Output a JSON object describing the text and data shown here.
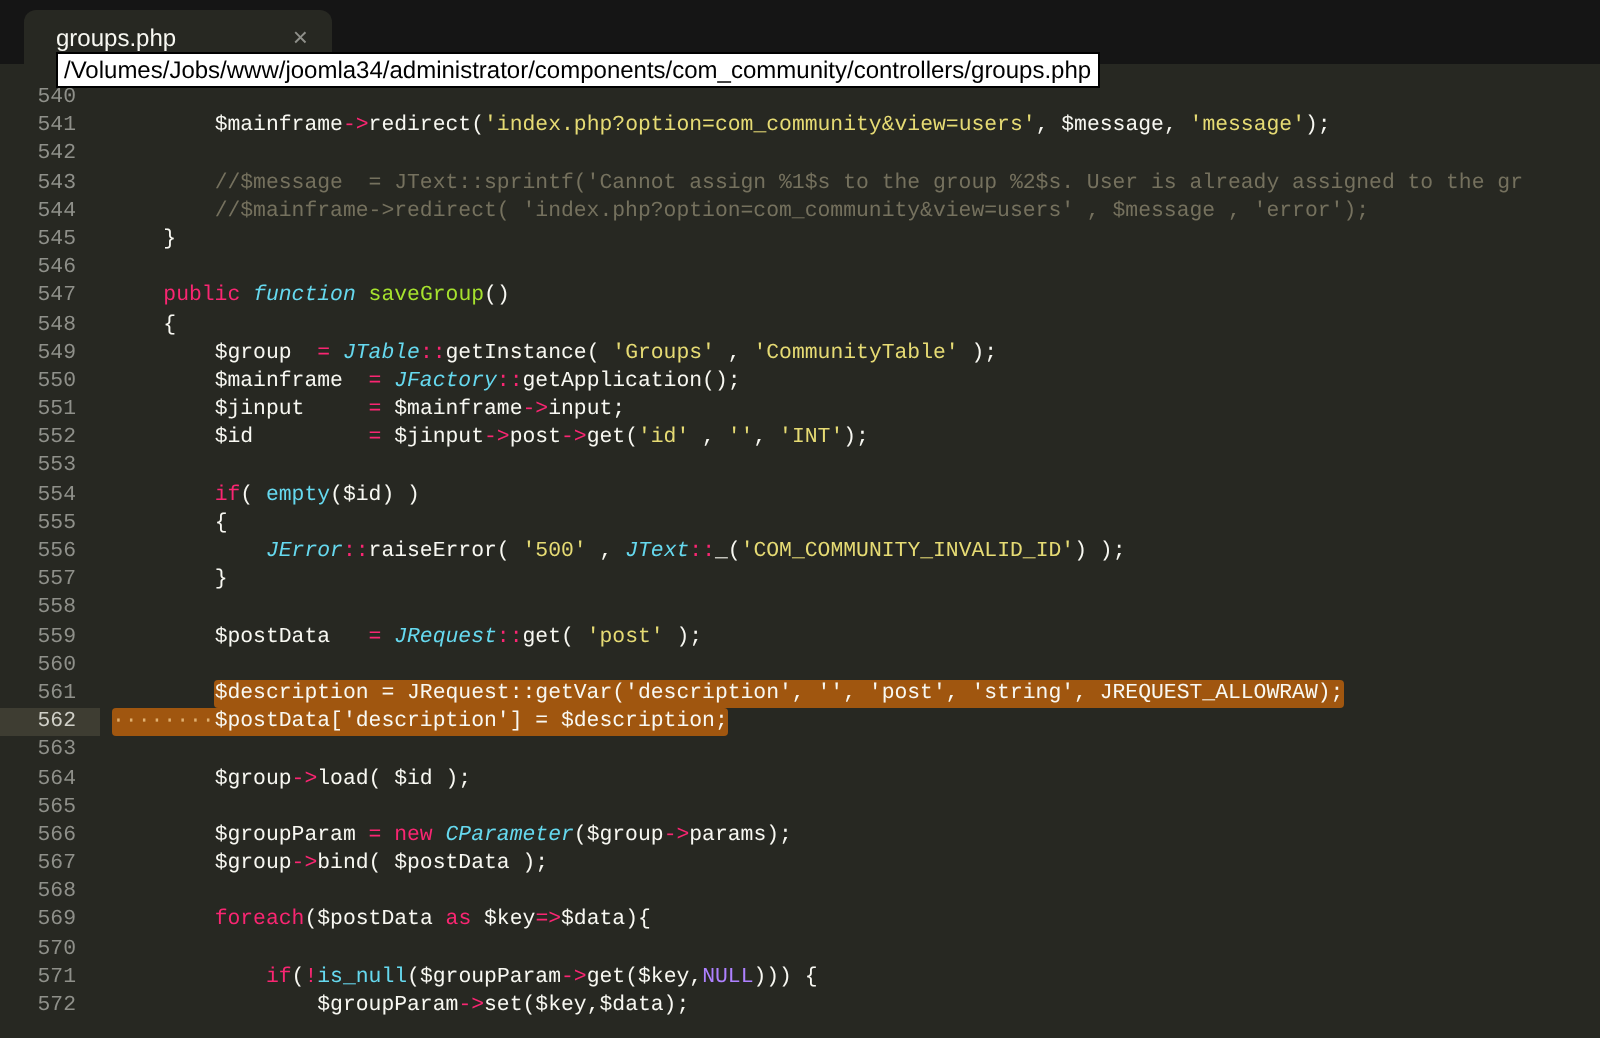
{
  "tab": {
    "title": "groups.php",
    "close": "×",
    "selected": true
  },
  "tooltip": {
    "text": "/Volumes/Jobs/www/joomla34/administrator/components/com_community/controllers/groups.php"
  },
  "lines": [
    {
      "number": "540",
      "selected": false,
      "current": false
    },
    {
      "number": "541",
      "selected": false,
      "current": false,
      "tokens": [
        {
          "text": "        $mainframe",
          "kind": "plain"
        },
        {
          "text": "->",
          "kind": "keyword"
        },
        {
          "text": "redirect(",
          "kind": "plain"
        },
        {
          "text": "'index.php?option=com_community&view=users'",
          "kind": "string"
        },
        {
          "text": ", $message, ",
          "kind": "plain"
        },
        {
          "text": "'message'",
          "kind": "string"
        },
        {
          "text": ");",
          "kind": "plain"
        }
      ]
    },
    {
      "number": "542",
      "selected": false,
      "current": false
    },
    {
      "number": "543",
      "selected": false,
      "current": false,
      "tokens": [
        {
          "text": "        //$message  = JText::sprintf('Cannot assign %1$s to the group %2$s. User is already assigned to the gr",
          "kind": "comment"
        }
      ]
    },
    {
      "number": "544",
      "selected": false,
      "current": false,
      "tokens": [
        {
          "text": "        //$mainframe->redirect( 'index.php?option=com_community&view=users' , $message , 'error');",
          "kind": "comment"
        }
      ]
    },
    {
      "number": "545",
      "selected": false,
      "current": false,
      "tokens": [
        {
          "text": "    }",
          "kind": "plain"
        }
      ]
    },
    {
      "number": "546",
      "selected": false,
      "current": false
    },
    {
      "number": "547",
      "selected": false,
      "current": false,
      "tokens": [
        {
          "text": "    public ",
          "kind": "keyword"
        },
        {
          "text": "function ",
          "kind": "storage"
        },
        {
          "text": "saveGroup",
          "kind": "function"
        },
        {
          "text": "()",
          "kind": "plain"
        }
      ]
    },
    {
      "number": "548",
      "selected": false,
      "current": false,
      "tokens": [
        {
          "text": "    {",
          "kind": "plain"
        }
      ]
    },
    {
      "number": "549",
      "selected": false,
      "current": false,
      "tokens": [
        {
          "text": "        $group  ",
          "kind": "plain"
        },
        {
          "text": "= ",
          "kind": "keyword"
        },
        {
          "text": "JTable",
          "kind": "class"
        },
        {
          "text": "::",
          "kind": "keyword"
        },
        {
          "text": "getInstance( ",
          "kind": "plain"
        },
        {
          "text": "'Groups'",
          "kind": "string"
        },
        {
          "text": " , ",
          "kind": "plain"
        },
        {
          "text": "'CommunityTable'",
          "kind": "string"
        },
        {
          "text": " );",
          "kind": "plain"
        }
      ]
    },
    {
      "number": "550",
      "selected": false,
      "current": false,
      "tokens": [
        {
          "text": "        $mainframe  ",
          "kind": "plain"
        },
        {
          "text": "= ",
          "kind": "keyword"
        },
        {
          "text": "JFactory",
          "kind": "class"
        },
        {
          "text": "::",
          "kind": "keyword"
        },
        {
          "text": "getApplication();",
          "kind": "plain"
        }
      ]
    },
    {
      "number": "551",
      "selected": false,
      "current": false,
      "tokens": [
        {
          "text": "        $jinput     ",
          "kind": "plain"
        },
        {
          "text": "=",
          "kind": "keyword"
        },
        {
          "text": " $mainframe",
          "kind": "plain"
        },
        {
          "text": "->",
          "kind": "keyword"
        },
        {
          "text": "input;",
          "kind": "plain"
        }
      ]
    },
    {
      "number": "552",
      "selected": false,
      "current": false,
      "tokens": [
        {
          "text": "        $id         ",
          "kind": "plain"
        },
        {
          "text": "=",
          "kind": "keyword"
        },
        {
          "text": " $jinput",
          "kind": "plain"
        },
        {
          "text": "->",
          "kind": "keyword"
        },
        {
          "text": "post",
          "kind": "plain"
        },
        {
          "text": "->",
          "kind": "keyword"
        },
        {
          "text": "get(",
          "kind": "plain"
        },
        {
          "text": "'id'",
          "kind": "string"
        },
        {
          "text": " , ",
          "kind": "plain"
        },
        {
          "text": "''",
          "kind": "string"
        },
        {
          "text": ", ",
          "kind": "plain"
        },
        {
          "text": "'INT'",
          "kind": "string"
        },
        {
          "text": ");",
          "kind": "plain"
        }
      ]
    },
    {
      "number": "553",
      "selected": false,
      "current": false
    },
    {
      "number": "554",
      "selected": false,
      "current": false,
      "tokens": [
        {
          "text": "        if",
          "kind": "keyword"
        },
        {
          "text": "( ",
          "kind": "plain"
        },
        {
          "text": "empty",
          "kind": "builtin"
        },
        {
          "text": "($id) )",
          "kind": "plain"
        }
      ]
    },
    {
      "number": "555",
      "selected": false,
      "current": false,
      "tokens": [
        {
          "text": "        {",
          "kind": "plain"
        }
      ]
    },
    {
      "number": "556",
      "selected": false,
      "current": false,
      "tokens": [
        {
          "text": "            JError",
          "kind": "class"
        },
        {
          "text": "::",
          "kind": "keyword"
        },
        {
          "text": "raiseError( ",
          "kind": "plain"
        },
        {
          "text": "'500'",
          "kind": "string"
        },
        {
          "text": " , ",
          "kind": "plain"
        },
        {
          "text": "JText",
          "kind": "class"
        },
        {
          "text": "::",
          "kind": "keyword"
        },
        {
          "text": "_(",
          "kind": "plain"
        },
        {
          "text": "'COM_COMMUNITY_INVALID_ID'",
          "kind": "string"
        },
        {
          "text": ") );",
          "kind": "plain"
        }
      ]
    },
    {
      "number": "557",
      "selected": false,
      "current": false,
      "tokens": [
        {
          "text": "        }",
          "kind": "plain"
        }
      ]
    },
    {
      "number": "558",
      "selected": false,
      "current": false
    },
    {
      "number": "559",
      "selected": false,
      "current": false,
      "tokens": [
        {
          "text": "        $postData   ",
          "kind": "plain"
        },
        {
          "text": "= ",
          "kind": "keyword"
        },
        {
          "text": "JRequest",
          "kind": "class"
        },
        {
          "text": "::",
          "kind": "keyword"
        },
        {
          "text": "get( ",
          "kind": "plain"
        },
        {
          "text": "'post'",
          "kind": "string"
        },
        {
          "text": " );",
          "kind": "plain"
        }
      ]
    },
    {
      "number": "560",
      "selected": false,
      "current": false
    },
    {
      "number": "561",
      "selected": true,
      "current": false,
      "tokens": [
        {
          "text": "        $description = JRequest::getVar('description', '', 'post', 'string', JREQUEST_ALLOWRAW);",
          "kind": "plain"
        }
      ]
    },
    {
      "number": "562",
      "selected": true,
      "current": true,
      "tokens": [
        {
          "text": "········",
          "kind": "whitespace"
        },
        {
          "text": "$postData['description'] = $description;",
          "kind": "plain"
        }
      ]
    },
    {
      "number": "563",
      "selected": false,
      "current": false
    },
    {
      "number": "564",
      "selected": false,
      "current": false,
      "tokens": [
        {
          "text": "        $group",
          "kind": "plain"
        },
        {
          "text": "->",
          "kind": "keyword"
        },
        {
          "text": "load( $id );",
          "kind": "plain"
        }
      ]
    },
    {
      "number": "565",
      "selected": false,
      "current": false
    },
    {
      "number": "566",
      "selected": false,
      "current": false,
      "tokens": [
        {
          "text": "        $groupParam ",
          "kind": "plain"
        },
        {
          "text": "= new ",
          "kind": "keyword"
        },
        {
          "text": "CParameter",
          "kind": "class"
        },
        {
          "text": "($group",
          "kind": "plain"
        },
        {
          "text": "->",
          "kind": "keyword"
        },
        {
          "text": "params);",
          "kind": "plain"
        }
      ]
    },
    {
      "number": "567",
      "selected": false,
      "current": false,
      "tokens": [
        {
          "text": "        $group",
          "kind": "plain"
        },
        {
          "text": "->",
          "kind": "keyword"
        },
        {
          "text": "bind( $postData );",
          "kind": "plain"
        }
      ]
    },
    {
      "number": "568",
      "selected": false,
      "current": false
    },
    {
      "number": "569",
      "selected": false,
      "current": false,
      "tokens": [
        {
          "text": "        foreach",
          "kind": "keyword"
        },
        {
          "text": "($postData ",
          "kind": "plain"
        },
        {
          "text": "as",
          "kind": "keyword"
        },
        {
          "text": " $key",
          "kind": "plain"
        },
        {
          "text": "=>",
          "kind": "keyword"
        },
        {
          "text": "$data){",
          "kind": "plain"
        }
      ]
    },
    {
      "number": "570",
      "selected": false,
      "current": false
    },
    {
      "number": "571",
      "selected": false,
      "current": false,
      "tokens": [
        {
          "text": "            if",
          "kind": "keyword"
        },
        {
          "text": "(",
          "kind": "plain"
        },
        {
          "text": "!",
          "kind": "keyword"
        },
        {
          "text": "is_null",
          "kind": "builtin"
        },
        {
          "text": "($groupParam",
          "kind": "plain"
        },
        {
          "text": "->",
          "kind": "keyword"
        },
        {
          "text": "get($key,",
          "kind": "plain"
        },
        {
          "text": "NULL",
          "kind": "constant"
        },
        {
          "text": "))) {",
          "kind": "plain"
        }
      ]
    },
    {
      "number": "572",
      "selected": false,
      "current": false,
      "tokens": [
        {
          "text": "                $groupParam",
          "kind": "plain"
        },
        {
          "text": "->",
          "kind": "keyword"
        },
        {
          "text": "set($key,$data);",
          "kind": "plain"
        }
      ]
    }
  ]
}
